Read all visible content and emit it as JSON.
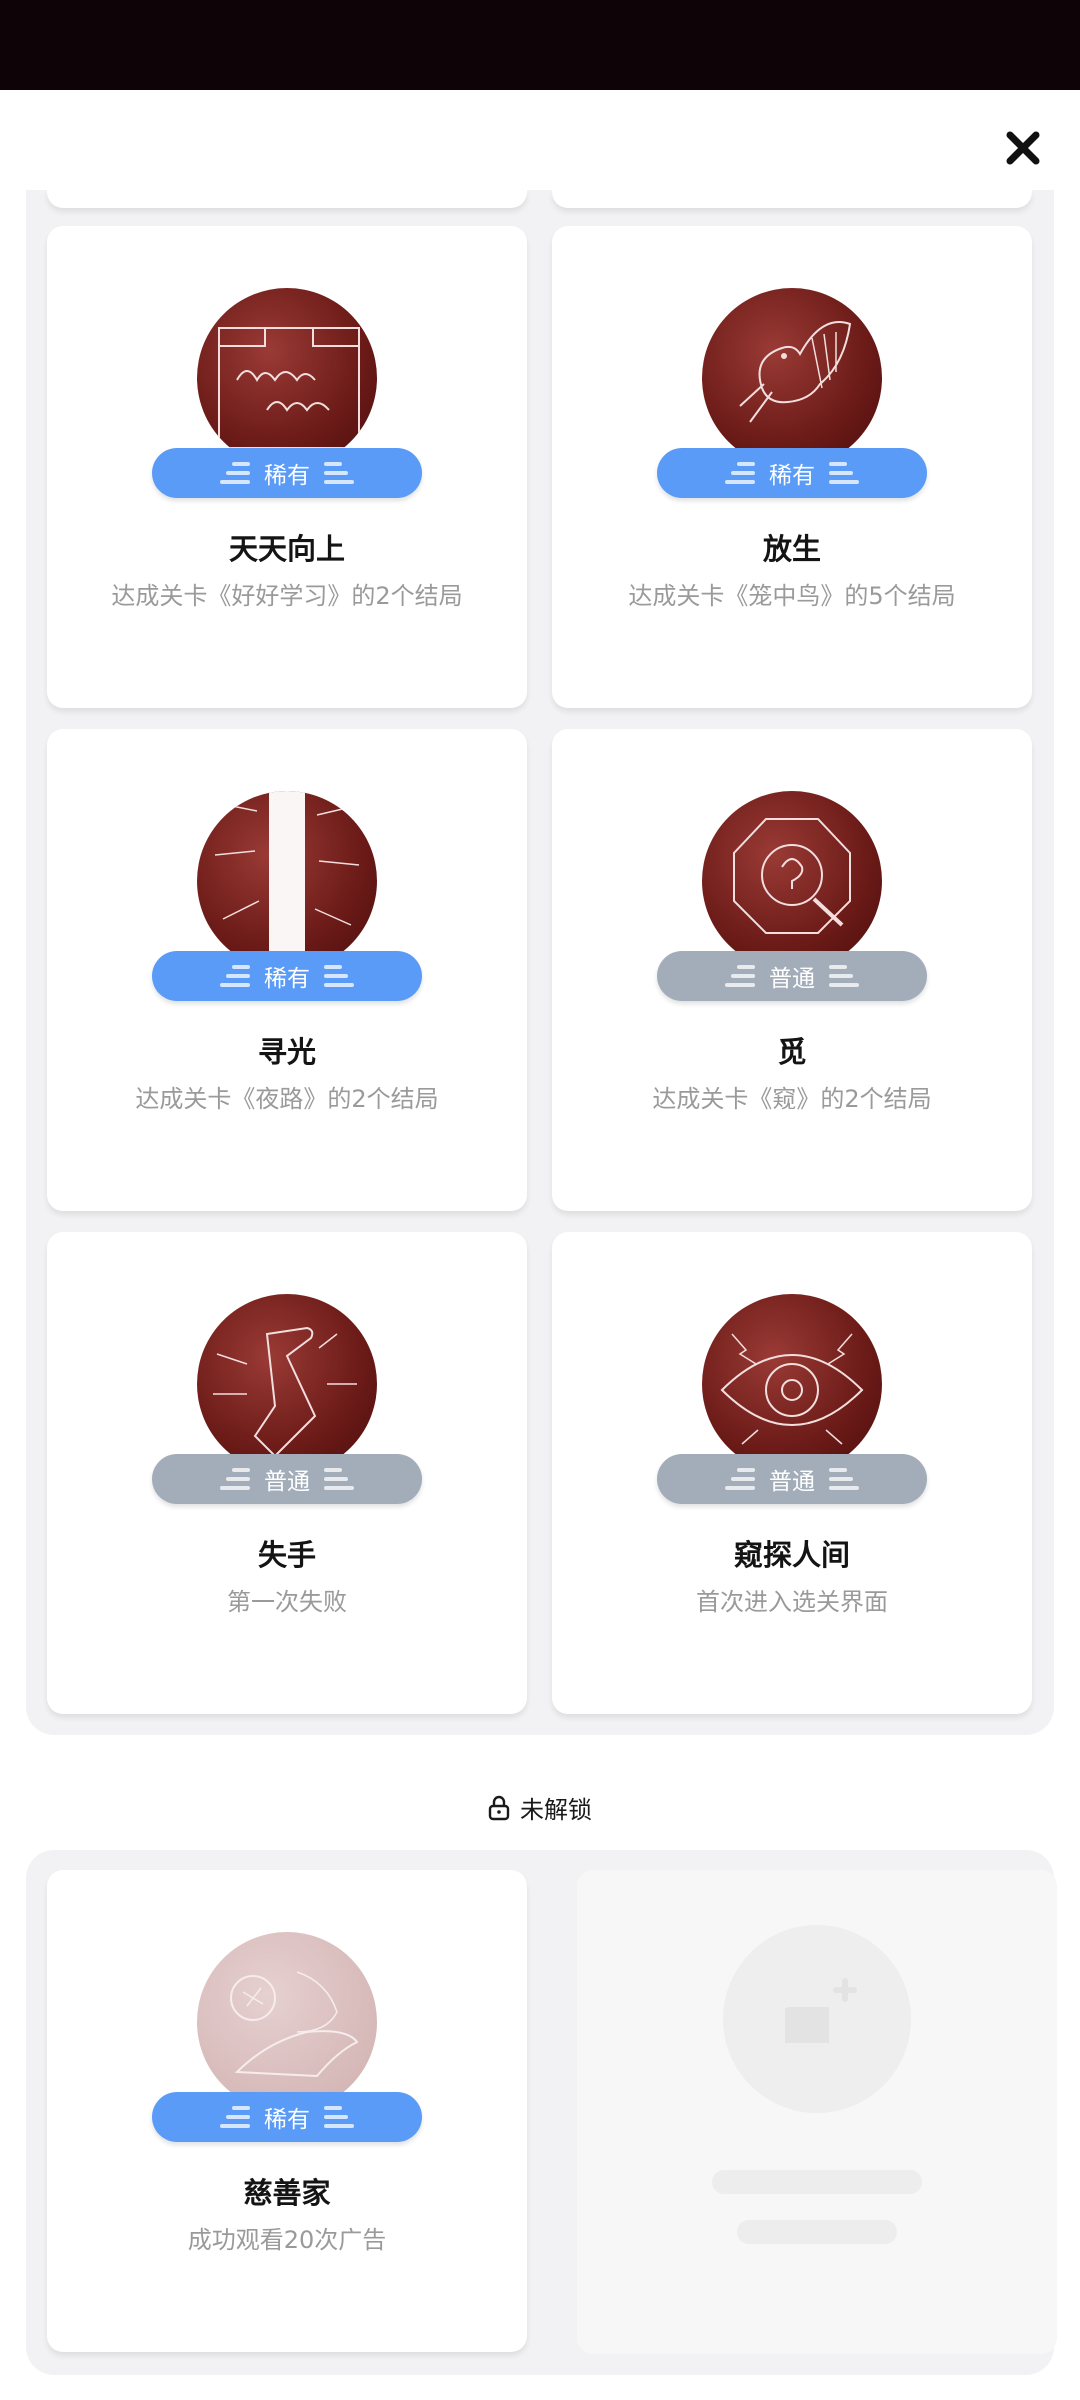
{
  "close_label": "×",
  "unlocked_badges": [
    {
      "title": "天天向上",
      "desc": "达成关卡《好好学习》的2个结局",
      "rarity": "稀有",
      "rarity_type": "rare",
      "icon": "blackboard-icon"
    },
    {
      "title": "放生",
      "desc": "达成关卡《笼中鸟》的5个结局",
      "rarity": "稀有",
      "rarity_type": "rare",
      "icon": "dove-icon"
    },
    {
      "title": "寻光",
      "desc": "达成关卡《夜路》的2个结局",
      "rarity": "稀有",
      "rarity_type": "rare",
      "icon": "light-beam-icon"
    },
    {
      "title": "觅",
      "desc": "达成关卡《窥》的2个结局",
      "rarity": "普通",
      "rarity_type": "common",
      "icon": "magnifier-icon"
    },
    {
      "title": "失手",
      "desc": "第一次失败",
      "rarity": "普通",
      "rarity_type": "common",
      "icon": "falling-hand-icon"
    },
    {
      "title": "窥探人间",
      "desc": "首次进入选关界面",
      "rarity": "普通",
      "rarity_type": "common",
      "icon": "eye-icon"
    }
  ],
  "locked_section": {
    "label": "未解锁",
    "icon": "lock-icon"
  },
  "locked_badges": [
    {
      "title": "慈善家",
      "desc": "成功观看20次广告",
      "rarity": "稀有",
      "rarity_type": "rare",
      "icon": "coin-hand-icon"
    }
  ],
  "placeholder_icon": "image-placeholder-icon",
  "colors": {
    "rare": "#5b9bf8",
    "common": "#a3adb9",
    "badge_red": "#6a1a17",
    "status_bar": "#0e0307",
    "panel_bg": "#f2f2f4"
  }
}
